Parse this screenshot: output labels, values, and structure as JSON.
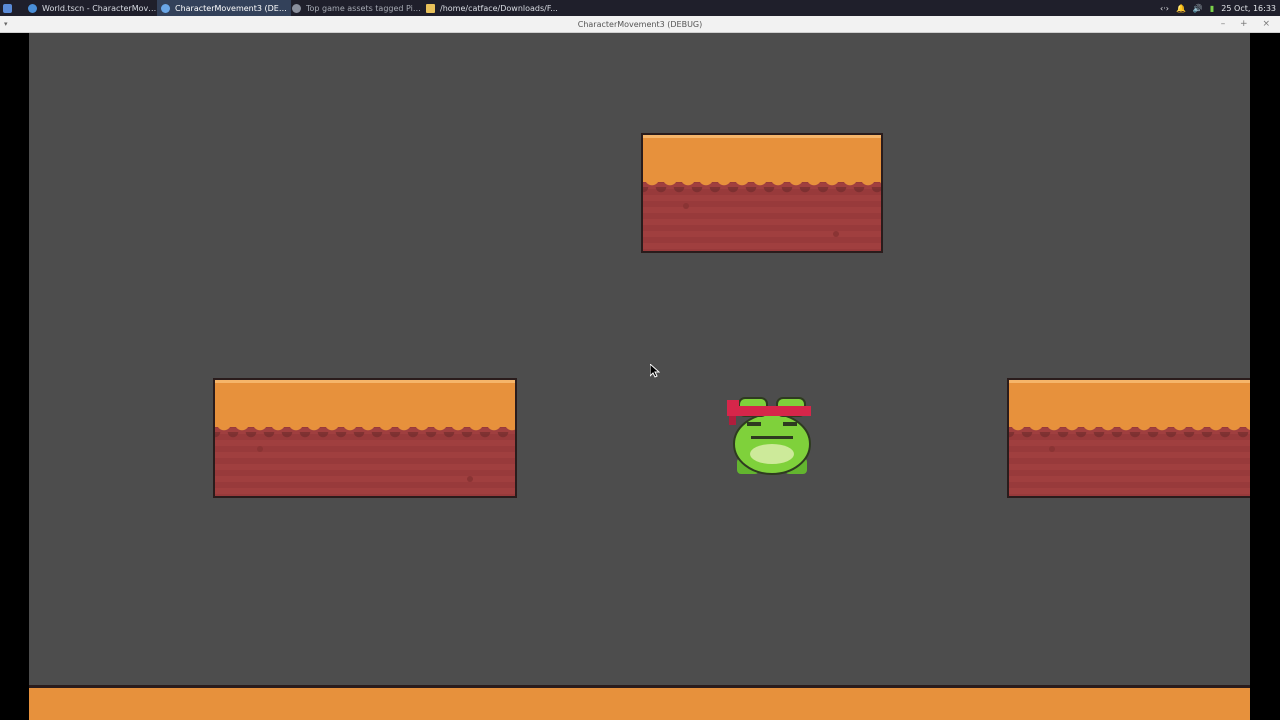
{
  "taskbar": {
    "apps": [
      {
        "label": "World.tscn - CharacterMove...",
        "icon": "godot-editor-icon",
        "color": "#4a8fd8",
        "active": false
      },
      {
        "label": "CharacterMovement3 (DEB...",
        "icon": "godot-game-icon",
        "color": "#6aa7e8",
        "active": true
      },
      {
        "label": "Top game assets tagged Pix...",
        "icon": "browser-icon",
        "color": "#8a8f9c",
        "active": false
      },
      {
        "label": "/home/catface/Downloads/F...",
        "icon": "folder-icon",
        "color": "#e8c15a",
        "active": false
      }
    ],
    "tray": {
      "network": "‹·›",
      "notifications": "🔔",
      "volume": "🔊",
      "battery": "▮",
      "clock": "25 Oct, 16:33"
    }
  },
  "window": {
    "title": "CharacterMovement3 (DEBUG)",
    "controls": "– + ×"
  },
  "scene": {
    "colors": {
      "background": "#4d4d4d",
      "grass": "#e7913c",
      "dirt": "#a03f3f",
      "outline": "#2a1c1c"
    },
    "objects": [
      "platform-top",
      "platform-left",
      "platform-right",
      "ground",
      "frog-player"
    ]
  }
}
